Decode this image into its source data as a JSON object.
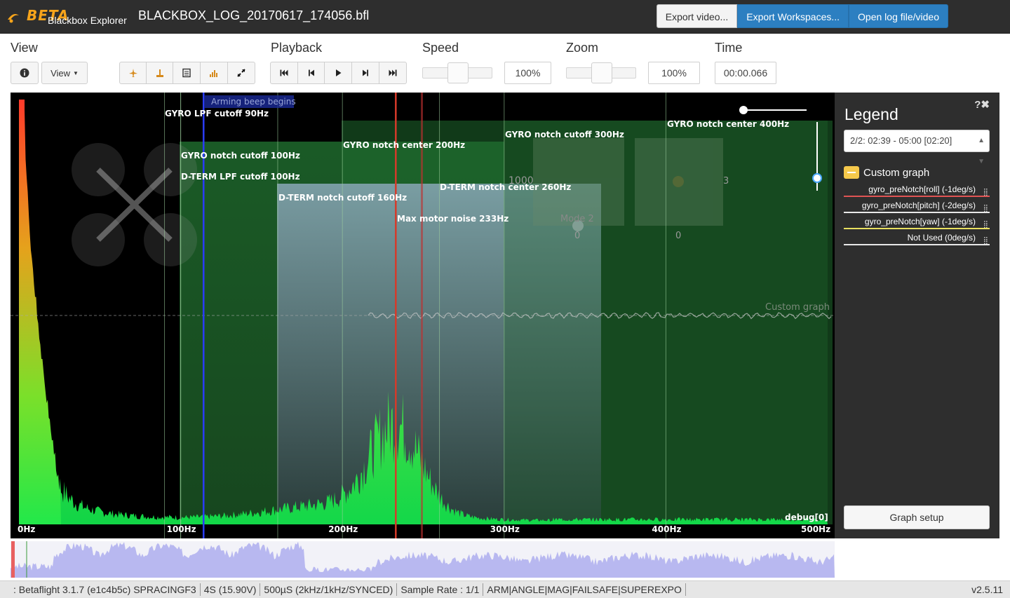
{
  "app": {
    "logo_text": "BETA",
    "logo_sub": "Blackbox Explorer",
    "filename": "BLACKBOX_LOG_20170617_174056.bfl"
  },
  "header_buttons": {
    "export_video": "Export video...",
    "export_workspaces": "Export Workspaces...",
    "open_log": "Open log file/video"
  },
  "toolbar": {
    "view_title": "View",
    "view_dropdown": "View",
    "playback_title": "Playback",
    "speed_title": "Speed",
    "speed_value": "100%",
    "speed_level": 0.5,
    "zoom_title": "Zoom",
    "zoom_value": "100%",
    "zoom_level": 0.5,
    "time_title": "Time",
    "time_value": "00:00.066",
    "view_icons": [
      "info-icon",
      "craft-icon",
      "sticks-icon",
      "table-icon",
      "spectrum-icon",
      "expand-icon"
    ],
    "playback_icons": [
      "skip-start-icon",
      "step-back-icon",
      "play-icon",
      "step-forward-icon",
      "skip-end-icon"
    ]
  },
  "graph": {
    "arming_label": "Arming beep begins",
    "filter_labels": {
      "gyro_lpf": "GYRO LPF cutoff 90Hz",
      "gyro_notch_cut100": "GYRO notch cutoff 100Hz",
      "dterm_lpf": "D-TERM LPF cutoff 100Hz",
      "dterm_notch_cut160": "D-TERM notch cutoff 160Hz",
      "gyro_notch_center200": "GYRO notch center 200Hz",
      "dterm_notch_center260": "D-TERM notch center 260Hz",
      "max_motor": "Max motor noise 233Hz",
      "gyro_notch_cut300": "GYRO notch cutoff 300Hz",
      "gyro_notch_center400": "GYRO notch center 400Hz"
    },
    "x_axis": [
      "0Hz",
      "100Hz",
      "200Hz",
      "300Hz",
      "400Hz",
      "500Hz"
    ],
    "debug_label": "debug[0]",
    "custom_graph_label": "Custom graph",
    "stick_labels": {
      "left_top": "1000",
      "left_mode": "Mode 2",
      "left_bottom": "0",
      "right_right": "3",
      "right_bottom": "0"
    }
  },
  "chart_data": {
    "type": "area",
    "title": "",
    "xlabel": "",
    "ylabel": "",
    "xlim": [
      0,
      500
    ],
    "x_unit": "Hz",
    "markers_hz": {
      "gyro_lpf_cutoff": 90,
      "gyro_notch_cutoff": 100,
      "dterm_lpf_cutoff": 100,
      "dterm_notch_cutoff": 160,
      "gyro_notch_center": 200,
      "max_motor_noise": 233,
      "dterm_notch_center": 260,
      "gyro_notch_cutoff_2": 300,
      "gyro_notch_center_2": 400
    }
  },
  "legend": {
    "title": "Legend",
    "close_glyph": "?✖",
    "range": "2/2: 02:39 - 05:00 [02:20]",
    "group": "Custom graph",
    "fields": [
      {
        "label": "gyro_preNotch[roll] (-1deg/s)",
        "color": "#e05454"
      },
      {
        "label": "gyro_preNotch[pitch] (-2deg/s)",
        "color": "#e8e8e8"
      },
      {
        "label": "gyro_preNotch[yaw] (-1deg/s)",
        "color": "#e8e060"
      },
      {
        "label": "Not Used (0deg/s)",
        "color": "#e8e8e8"
      }
    ],
    "graph_setup": "Graph setup"
  },
  "status": {
    "segments": [
      ": Betaflight 3.1.7 (e1c4b5c) SPRACINGF3",
      "4S (15.90V)",
      "500µS (2kHz/1kHz/SYNCED)",
      "Sample Rate : 1/1",
      "ARM|ANGLE|MAG|FAILSAFE|SUPEREXPO"
    ],
    "version": "v2.5.11"
  },
  "colors": {
    "accent": "#2c7fc1",
    "logo": "#f7a41b",
    "spectrum": "#22ee22",
    "motor_line": "#d63a2a",
    "notch_fill": "#2f7a3a",
    "dterm_fill": "#7a9aa8"
  }
}
